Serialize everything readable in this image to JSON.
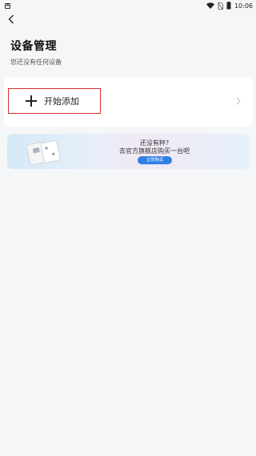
{
  "status_bar": {
    "notification_icon": "A",
    "time": "10:06"
  },
  "header": {
    "title": "设备管理",
    "subtitle": "您还没有任何设备"
  },
  "add_card": {
    "label": "开始添加"
  },
  "banner": {
    "line1": "还没有秤?",
    "line2": "去官方旗舰店购买一台吧",
    "button_label": "立即购买"
  },
  "colors": {
    "highlight_border": "#d32f2f",
    "button_blue": "#2f7fe6",
    "background": "#f5f6f7"
  }
}
